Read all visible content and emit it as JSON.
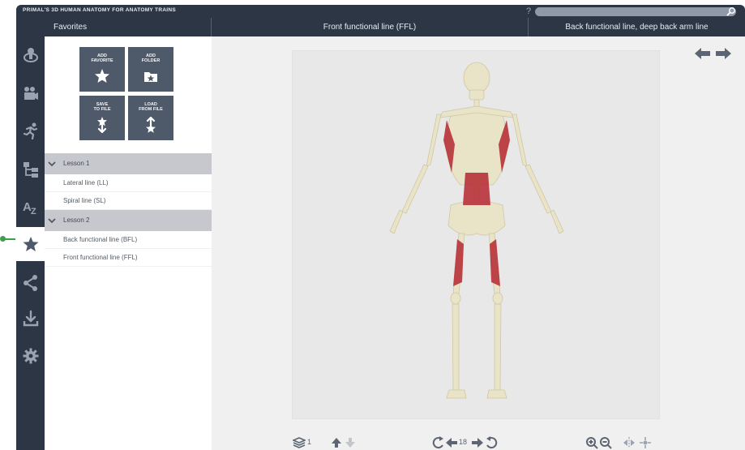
{
  "app": {
    "title": "PRIMAL'S 3D HUMAN ANATOMY FOR ANATOMY TRAINS",
    "help_label": "?",
    "search_placeholder": ""
  },
  "tabs": [
    {
      "label": "Favorites"
    },
    {
      "label": "Front functional line (FFL)"
    },
    {
      "label": "Back functional line, deep back arm line"
    }
  ],
  "sidebar": {
    "items": [
      {
        "icon": "anatomy-model-icon"
      },
      {
        "icon": "video-icon"
      },
      {
        "icon": "running-figure-icon"
      },
      {
        "icon": "hierarchy-tree-icon"
      },
      {
        "icon": "az-index-icon"
      },
      {
        "icon": "star-favorites-icon",
        "active": true
      },
      {
        "icon": "share-icon"
      },
      {
        "icon": "download-icon"
      },
      {
        "icon": "settings-gear-icon"
      }
    ]
  },
  "favorites": {
    "actions": [
      {
        "label": "ADD\nFAVORITE",
        "icon": "star-icon"
      },
      {
        "label": "ADD\nFOLDER",
        "icon": "add-folder-icon"
      },
      {
        "label": "SAVE\nTO FILE",
        "icon": "save-file-icon"
      },
      {
        "label": "LOAD\nFROM FILE",
        "icon": "load-file-icon"
      }
    ],
    "groups": [
      {
        "label": "Lesson 1",
        "items": [
          "Lateral line (LL)",
          "Spiral line (SL)"
        ]
      },
      {
        "label": "Lesson 2",
        "items": [
          "Back functional line (BFL)",
          "Front functional line (FFL)"
        ]
      }
    ]
  },
  "bottom_toolbar": {
    "layer_count": "1",
    "view_number": "18"
  },
  "colors": {
    "chrome": "#2d3645",
    "tile": "#4e596a",
    "group_row": "#c7c8cd",
    "muscle": "#b8333a",
    "bone": "#e7e1c4",
    "indicator": "#3aa04a"
  }
}
